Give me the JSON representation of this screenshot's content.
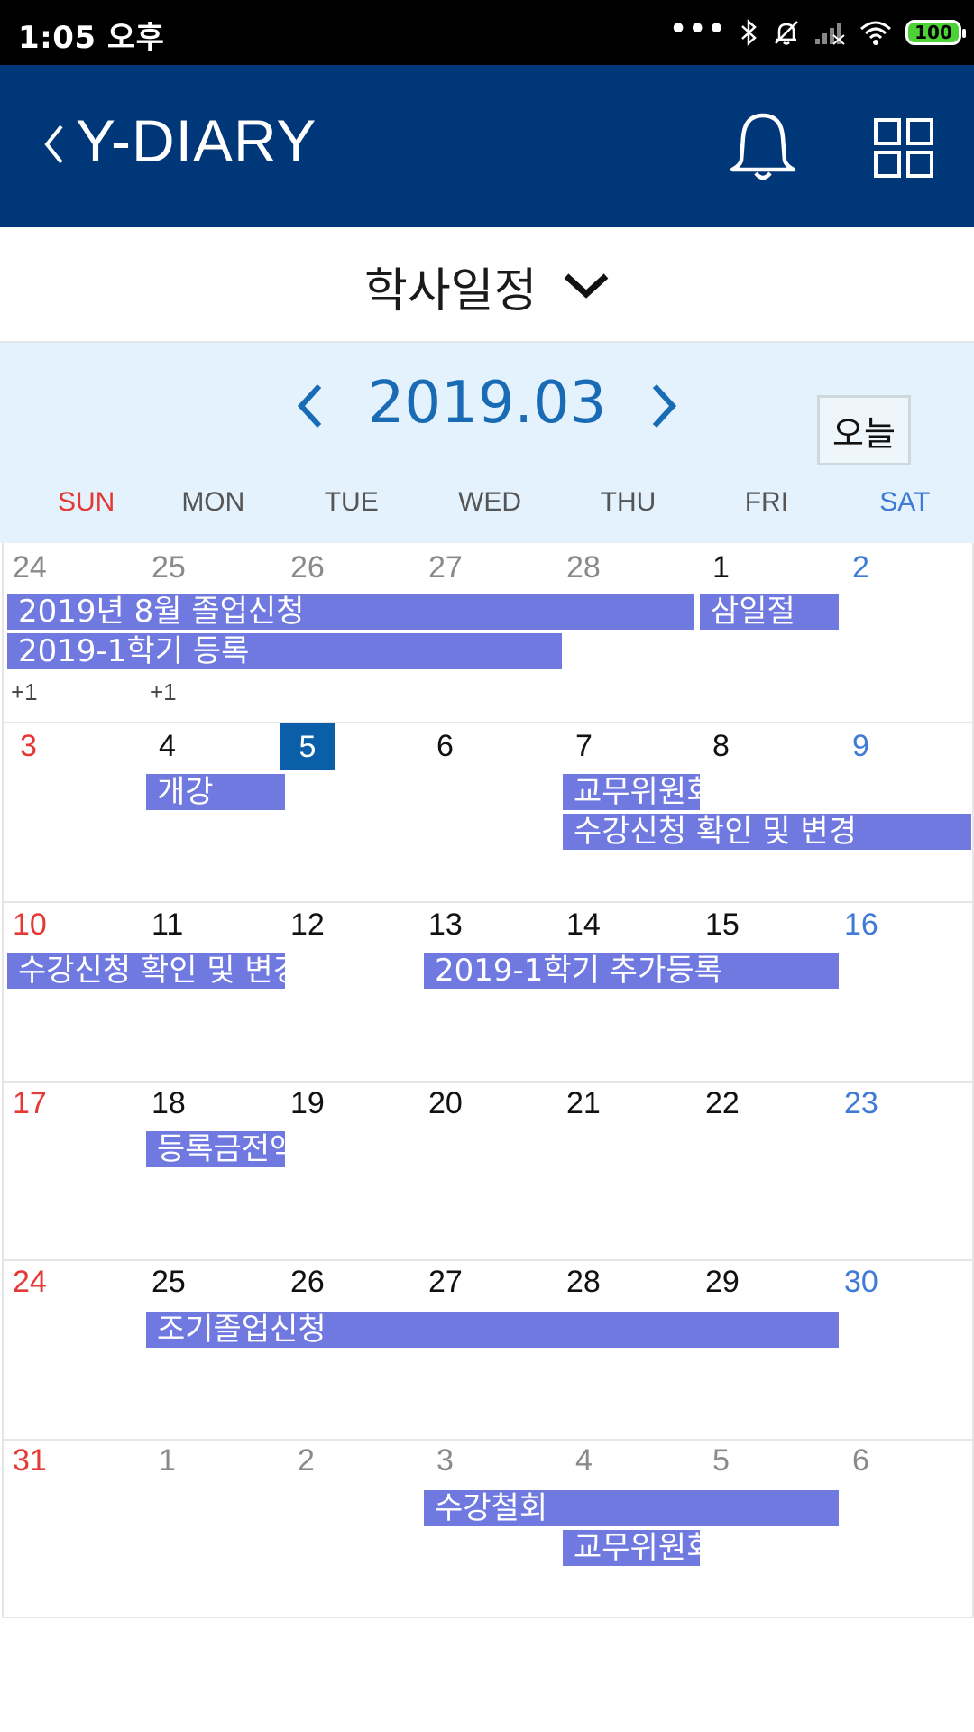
{
  "status_bar": {
    "time": "1:05 오후",
    "dots": "•••",
    "battery": "100",
    "icons": [
      "bluetooth-icon",
      "mute-bell-icon",
      "signal-icon",
      "wifi-icon",
      "battery-icon"
    ]
  },
  "app_bar": {
    "title": "Y-DIARY",
    "icons": [
      "back-icon",
      "bell-icon",
      "grid-menu-icon"
    ],
    "background": "#003778"
  },
  "selector": {
    "label": "학사일정",
    "icon": "chevron-down-icon"
  },
  "calendar": {
    "month_label": "2019.03",
    "today_button": "오늘",
    "accent": "#1a6bb5",
    "event_color": "#7079e0",
    "today_color": "#0b5fa8",
    "weekdays": [
      "SUN",
      "MON",
      "TUE",
      "WED",
      "THU",
      "FRI",
      "SAT"
    ],
    "weeks": [
      {
        "days": [
          "24",
          "25",
          "26",
          "27",
          "28",
          "1",
          "2"
        ],
        "events": [
          {
            "label": "2019년 8월 졸업신청"
          },
          {
            "label": "삼일절"
          },
          {
            "label": "2019-1학기 등록"
          }
        ],
        "more": [
          "+1",
          "+1"
        ]
      },
      {
        "days": [
          "3",
          "4",
          "5",
          "6",
          "7",
          "8",
          "9"
        ],
        "events": [
          {
            "label": "개강"
          },
          {
            "label": "교무위원회"
          },
          {
            "label": "수강신청 확인 및 변경"
          }
        ]
      },
      {
        "days": [
          "10",
          "11",
          "12",
          "13",
          "14",
          "15",
          "16"
        ],
        "events": [
          {
            "label": "수강신청 확인 및 변경"
          },
          {
            "label": "2019-1학기 추가등록"
          }
        ]
      },
      {
        "days": [
          "17",
          "18",
          "19",
          "20",
          "21",
          "22",
          "23"
        ],
        "events": [
          {
            "label": "등록금전액"
          }
        ]
      },
      {
        "days": [
          "24",
          "25",
          "26",
          "27",
          "28",
          "29",
          "30"
        ],
        "events": [
          {
            "label": "조기졸업신청"
          }
        ]
      },
      {
        "days": [
          "31",
          "1",
          "2",
          "3",
          "4",
          "5",
          "6"
        ],
        "events": [
          {
            "label": "수강철회"
          },
          {
            "label": "교무위원회"
          }
        ]
      }
    ]
  }
}
